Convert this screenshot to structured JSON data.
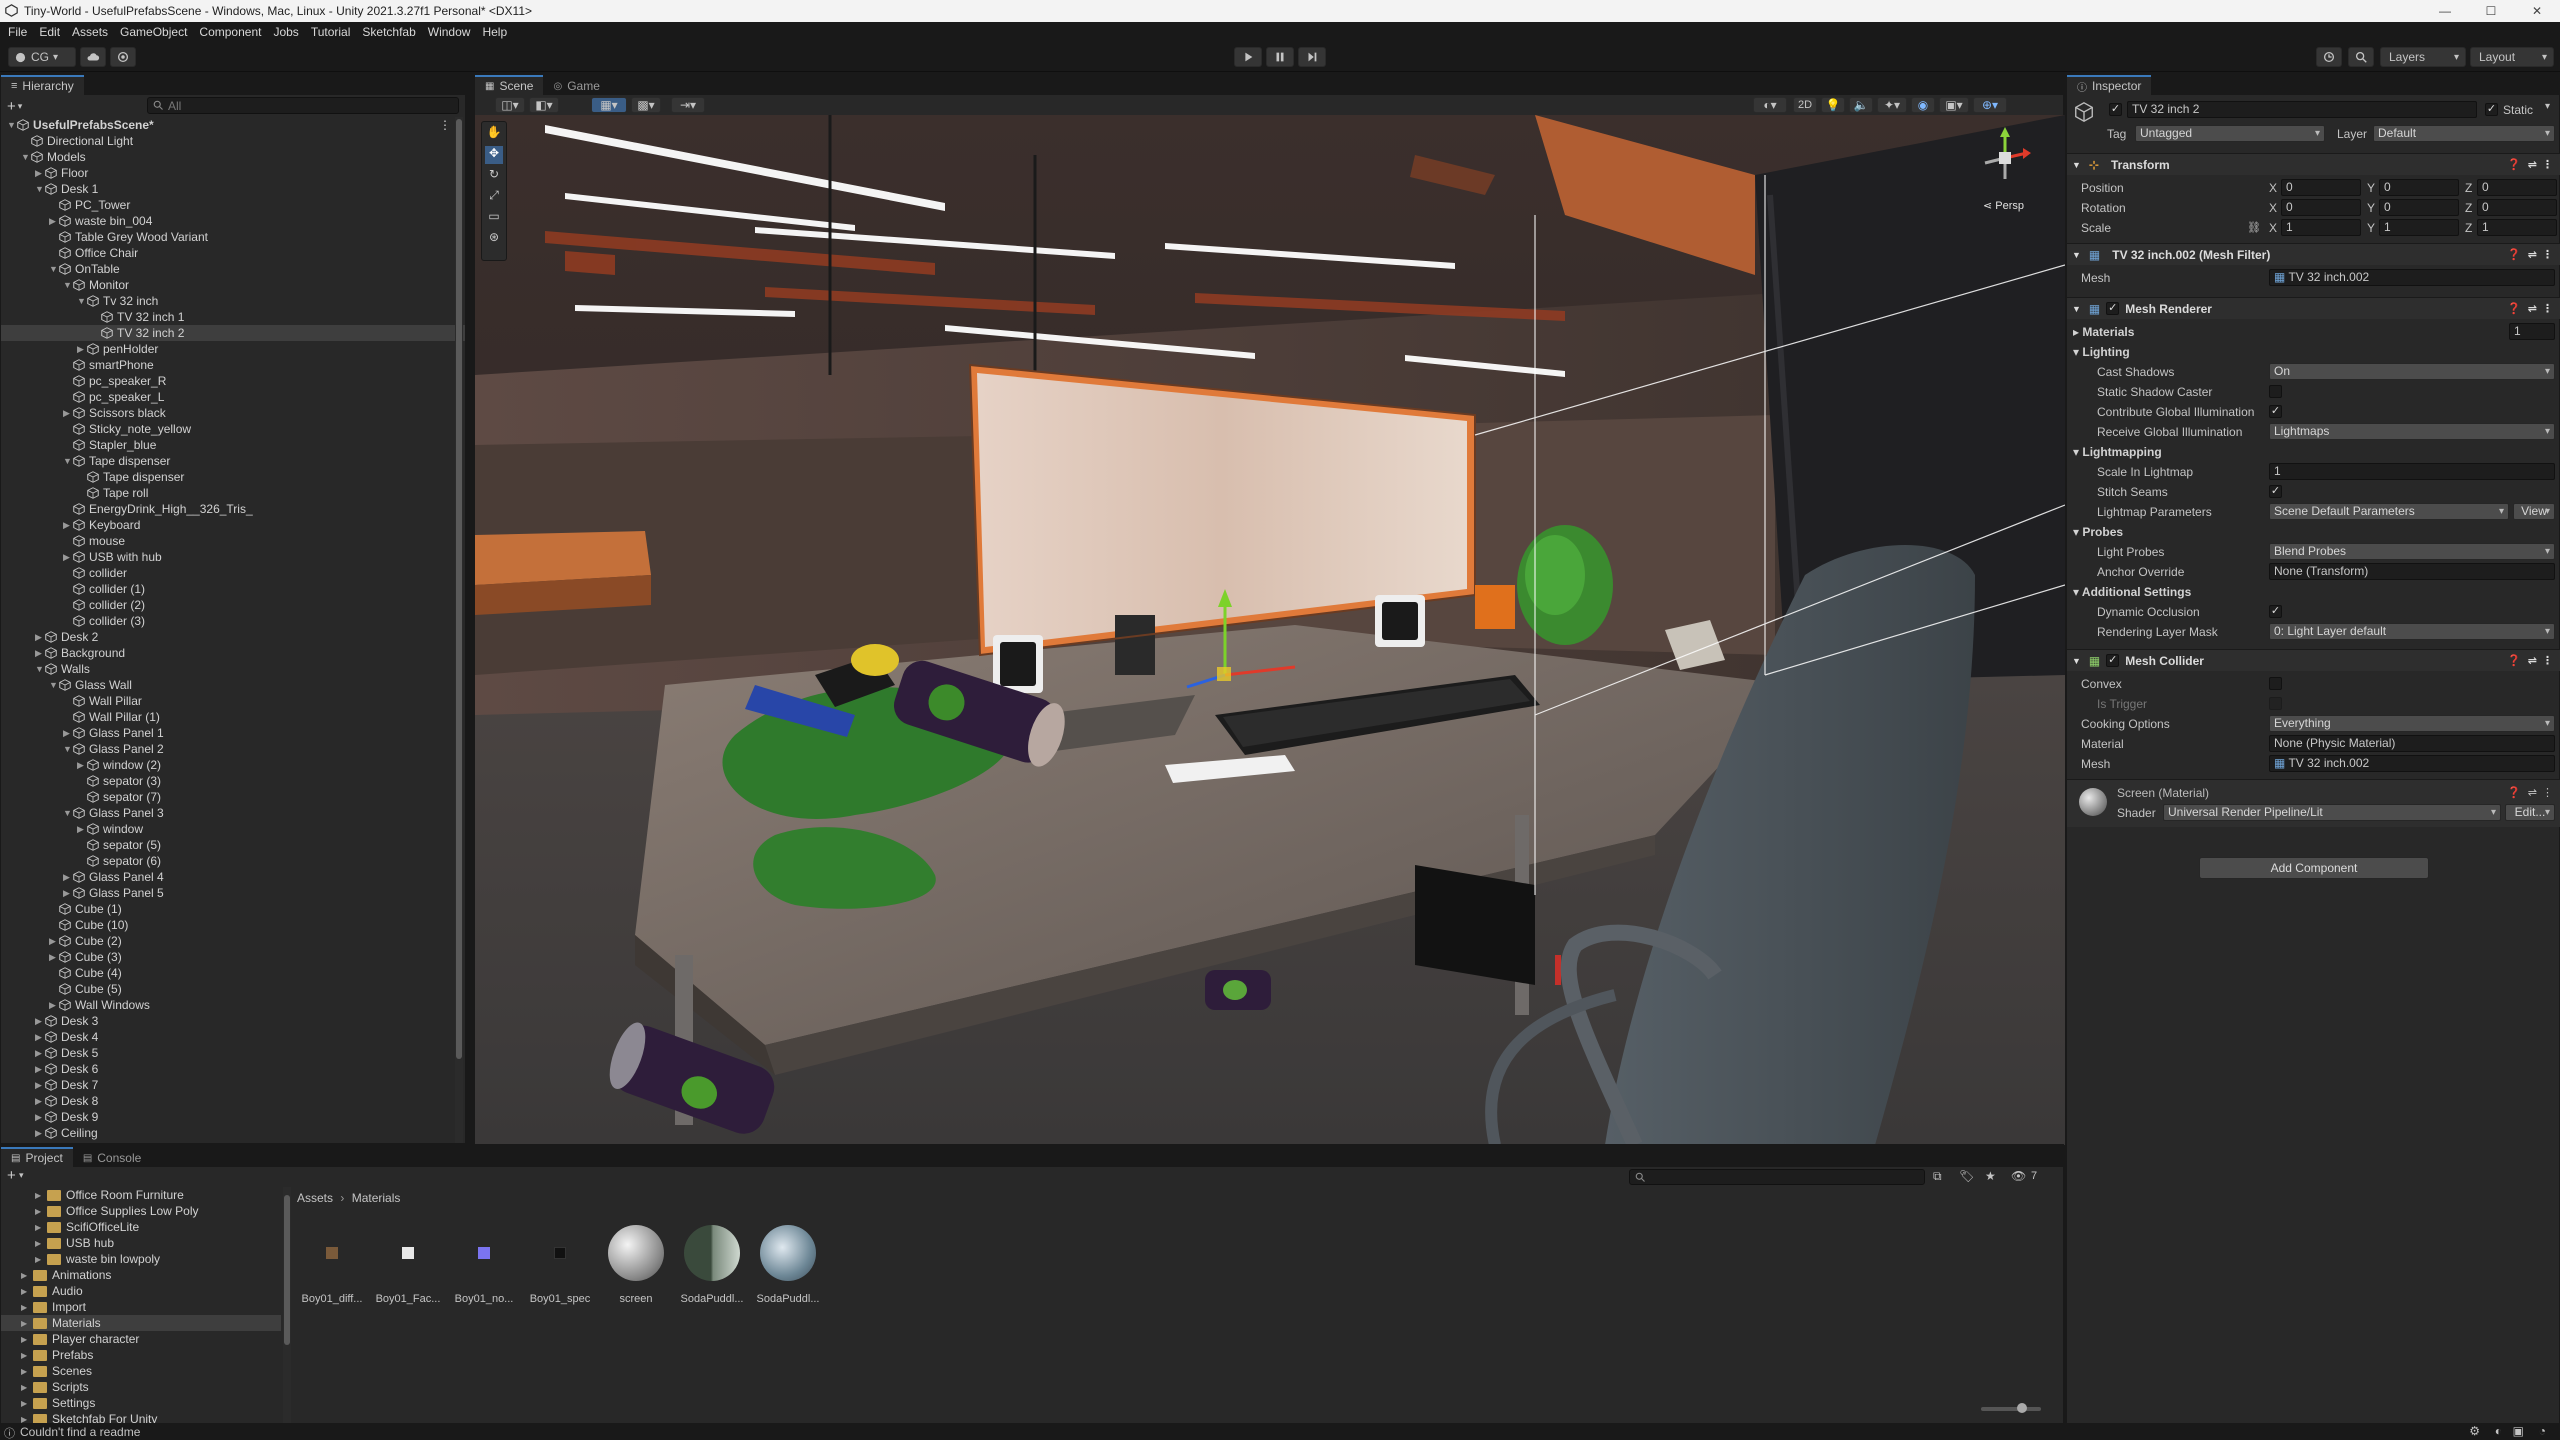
{
  "window": {
    "title": "Tiny-World - UsefulPrefabsScene - Windows, Mac, Linux - Unity 2021.3.27f1 Personal* <DX11>"
  },
  "menu": [
    "File",
    "Edit",
    "Assets",
    "GameObject",
    "Component",
    "Jobs",
    "Tutorial",
    "Sketchfab",
    "Window",
    "Help"
  ],
  "toolbar": {
    "account": "CG",
    "layers": "Layers",
    "layout": "Layout"
  },
  "hierarchy": {
    "tab": "Hierarchy",
    "search_placeholder": "All",
    "items": [
      {
        "label": "UsefulPrefabsScene*",
        "depth": 0,
        "arrow": "open",
        "scene": true
      },
      {
        "label": "Directional Light",
        "depth": 1,
        "arrow": ""
      },
      {
        "label": "Models",
        "depth": 1,
        "arrow": "open"
      },
      {
        "label": "Floor",
        "depth": 2,
        "arrow": "closed"
      },
      {
        "label": "Desk 1",
        "depth": 2,
        "arrow": "open"
      },
      {
        "label": "PC_Tower",
        "depth": 3,
        "arrow": ""
      },
      {
        "label": "waste bin_004",
        "depth": 3,
        "arrow": "closed"
      },
      {
        "label": "Table Grey Wood Variant",
        "depth": 3,
        "arrow": ""
      },
      {
        "label": "Office Chair",
        "depth": 3,
        "arrow": ""
      },
      {
        "label": "OnTable",
        "depth": 3,
        "arrow": "open"
      },
      {
        "label": "Monitor",
        "depth": 4,
        "arrow": "open"
      },
      {
        "label": "Tv 32 inch",
        "depth": 5,
        "arrow": "open"
      },
      {
        "label": "TV 32 inch 1",
        "depth": 6,
        "arrow": ""
      },
      {
        "label": "TV 32 inch 2",
        "depth": 6,
        "arrow": "",
        "selected": true
      },
      {
        "label": "penHolder",
        "depth": 5,
        "arrow": "closed"
      },
      {
        "label": "smartPhone",
        "depth": 4,
        "arrow": ""
      },
      {
        "label": "pc_speaker_R",
        "depth": 4,
        "arrow": ""
      },
      {
        "label": "pc_speaker_L",
        "depth": 4,
        "arrow": ""
      },
      {
        "label": "Scissors black",
        "depth": 4,
        "arrow": "closed"
      },
      {
        "label": "Sticky_note_yellow",
        "depth": 4,
        "arrow": ""
      },
      {
        "label": "Stapler_blue",
        "depth": 4,
        "arrow": ""
      },
      {
        "label": "Tape dispenser",
        "depth": 4,
        "arrow": "open"
      },
      {
        "label": "Tape dispenser",
        "depth": 5,
        "arrow": ""
      },
      {
        "label": "Tape roll",
        "depth": 5,
        "arrow": ""
      },
      {
        "label": "EnergyDrink_High__326_Tris_",
        "depth": 4,
        "arrow": ""
      },
      {
        "label": "Keyboard",
        "depth": 4,
        "arrow": "closed"
      },
      {
        "label": "mouse",
        "depth": 4,
        "arrow": ""
      },
      {
        "label": "USB with hub",
        "depth": 4,
        "arrow": "closed"
      },
      {
        "label": "collider",
        "depth": 4,
        "arrow": ""
      },
      {
        "label": "collider (1)",
        "depth": 4,
        "arrow": ""
      },
      {
        "label": "collider (2)",
        "depth": 4,
        "arrow": ""
      },
      {
        "label": "collider (3)",
        "depth": 4,
        "arrow": ""
      },
      {
        "label": "Desk 2",
        "depth": 2,
        "arrow": "closed"
      },
      {
        "label": "Background",
        "depth": 2,
        "arrow": "closed"
      },
      {
        "label": "Walls",
        "depth": 2,
        "arrow": "open"
      },
      {
        "label": "Glass Wall",
        "depth": 3,
        "arrow": "open"
      },
      {
        "label": "Wall Pillar",
        "depth": 4,
        "arrow": ""
      },
      {
        "label": "Wall Pillar (1)",
        "depth": 4,
        "arrow": ""
      },
      {
        "label": "Glass Panel 1",
        "depth": 4,
        "arrow": "closed"
      },
      {
        "label": "Glass Panel 2",
        "depth": 4,
        "arrow": "open"
      },
      {
        "label": "window (2)",
        "depth": 5,
        "arrow": "closed"
      },
      {
        "label": "sepator (3)",
        "depth": 5,
        "arrow": ""
      },
      {
        "label": "sepator (7)",
        "depth": 5,
        "arrow": ""
      },
      {
        "label": "Glass Panel 3",
        "depth": 4,
        "arrow": "open"
      },
      {
        "label": "window",
        "depth": 5,
        "arrow": "closed"
      },
      {
        "label": "sepator (5)",
        "depth": 5,
        "arrow": ""
      },
      {
        "label": "sepator (6)",
        "depth": 5,
        "arrow": ""
      },
      {
        "label": "Glass Panel 4",
        "depth": 4,
        "arrow": "closed"
      },
      {
        "label": "Glass Panel 5",
        "depth": 4,
        "arrow": "closed"
      },
      {
        "label": "Cube (1)",
        "depth": 3,
        "arrow": ""
      },
      {
        "label": "Cube (10)",
        "depth": 3,
        "arrow": ""
      },
      {
        "label": "Cube (2)",
        "depth": 3,
        "arrow": "closed"
      },
      {
        "label": "Cube (3)",
        "depth": 3,
        "arrow": "closed"
      },
      {
        "label": "Cube (4)",
        "depth": 3,
        "arrow": ""
      },
      {
        "label": "Cube (5)",
        "depth": 3,
        "arrow": ""
      },
      {
        "label": "Wall Windows",
        "depth": 3,
        "arrow": "closed"
      },
      {
        "label": "Desk 3",
        "depth": 2,
        "arrow": "closed"
      },
      {
        "label": "Desk 4",
        "depth": 2,
        "arrow": "closed"
      },
      {
        "label": "Desk 5",
        "depth": 2,
        "arrow": "closed"
      },
      {
        "label": "Desk 6",
        "depth": 2,
        "arrow": "closed"
      },
      {
        "label": "Desk 7",
        "depth": 2,
        "arrow": "closed"
      },
      {
        "label": "Desk 8",
        "depth": 2,
        "arrow": "closed"
      },
      {
        "label": "Desk 9",
        "depth": 2,
        "arrow": "closed"
      },
      {
        "label": "Ceiling",
        "depth": 2,
        "arrow": "closed"
      }
    ]
  },
  "scene": {
    "tab_scene": "Scene",
    "tab_game": "Game",
    "mode_2d": "2D",
    "persp": "Persp"
  },
  "inspector": {
    "tab": "Inspector",
    "object_name": "TV 32 inch 2",
    "static_label": "Static",
    "tag_label": "Tag",
    "tag_value": "Untagged",
    "layer_label": "Layer",
    "layer_value": "Default",
    "transform": {
      "title": "Transform",
      "position_label": "Position",
      "rotation_label": "Rotation",
      "scale_label": "Scale",
      "position": [
        "0",
        "0",
        "0"
      ],
      "rotation": [
        "0",
        "0",
        "0"
      ],
      "scale": [
        "1",
        "1",
        "1"
      ]
    },
    "mesh_filter": {
      "title": "TV 32 inch.002 (Mesh Filter)",
      "mesh_label": "Mesh",
      "mesh_value": "TV 32 inch.002"
    },
    "mesh_renderer": {
      "title": "Mesh Renderer",
      "materials_label": "Materials",
      "materials_count": "1",
      "lighting_label": "Lighting",
      "cast_shadows_label": "Cast Shadows",
      "cast_shadows_value": "On",
      "static_shadow_label": "Static Shadow Caster",
      "contribute_gi_label": "Contribute Global Illumination",
      "receive_gi_label": "Receive Global Illumination",
      "receive_gi_value": "Lightmaps",
      "lightmapping_label": "Lightmapping",
      "scale_lightmap_label": "Scale In Lightmap",
      "scale_lightmap_value": "1",
      "stitch_seams_label": "Stitch Seams",
      "lightmap_params_label": "Lightmap Parameters",
      "lightmap_params_value": "Scene Default Parameters",
      "view_label": "View",
      "probes_label": "Probes",
      "light_probes_label": "Light Probes",
      "light_probes_value": "Blend Probes",
      "anchor_override_label": "Anchor Override",
      "anchor_override_value": "None (Transform)",
      "additional_label": "Additional Settings",
      "dynamic_occlusion_label": "Dynamic Occlusion",
      "rendering_layer_label": "Rendering Layer Mask",
      "rendering_layer_value": "0: Light Layer default"
    },
    "mesh_collider": {
      "title": "Mesh Collider",
      "convex_label": "Convex",
      "is_trigger_label": "Is Trigger",
      "cooking_label": "Cooking Options",
      "cooking_value": "Everything",
      "material_label": "Material",
      "material_value": "None (Physic Material)",
      "mesh_label": "Mesh",
      "mesh_value": "TV 32 inch.002"
    },
    "material": {
      "title": "Screen (Material)",
      "shader_label": "Shader",
      "shader_value": "Universal Render Pipeline/Lit",
      "edit_label": "Edit..."
    },
    "add_component": "Add Component"
  },
  "project": {
    "tab_project": "Project",
    "tab_console": "Console",
    "breadcrumb_root": "Assets",
    "breadcrumb_current": "Materials",
    "hidden_count": "7",
    "folders": [
      {
        "label": "Office Room Furniture",
        "depth": 2
      },
      {
        "label": "Office Supplies Low Poly",
        "depth": 2
      },
      {
        "label": "ScifiOfficeLite",
        "depth": 2
      },
      {
        "label": "USB hub",
        "depth": 2
      },
      {
        "label": "waste bin lowpoly",
        "depth": 2
      },
      {
        "label": "Animations",
        "depth": 1
      },
      {
        "label": "Audio",
        "depth": 1
      },
      {
        "label": "Import",
        "depth": 1
      },
      {
        "label": "Materials",
        "depth": 1,
        "selected": true
      },
      {
        "label": "Player character",
        "depth": 1
      },
      {
        "label": "Prefabs",
        "depth": 1
      },
      {
        "label": "Scenes",
        "depth": 1
      },
      {
        "label": "Scripts",
        "depth": 1
      },
      {
        "label": "Settings",
        "depth": 1
      },
      {
        "label": "Sketchfab For Unity",
        "depth": 1
      }
    ],
    "assets": [
      {
        "label": "Boy01_diff...",
        "kind": "tex-brown"
      },
      {
        "label": "Boy01_Fac...",
        "kind": "tex-white"
      },
      {
        "label": "Boy01_no...",
        "kind": "tex-violet"
      },
      {
        "label": "Boy01_spec",
        "kind": "tex-dark"
      },
      {
        "label": "screen",
        "kind": "sphere-grey"
      },
      {
        "label": "SodaPuddl...",
        "kind": "sphere-dark"
      },
      {
        "label": "SodaPuddl...",
        "kind": "sphere-glass"
      }
    ]
  },
  "status": {
    "message": "Couldn't find a readme"
  },
  "colors": {
    "accent": "#3a79bb",
    "selection": "#3e3e3e",
    "folder": "#c6a14f"
  }
}
